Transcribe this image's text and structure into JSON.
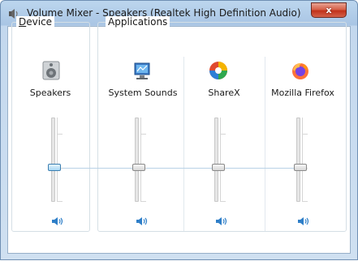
{
  "window": {
    "title": "Volume Mixer - Speakers (Realtek High Definition Audio)",
    "close_label": "x"
  },
  "groups": {
    "device_label_underlined": "D",
    "device_label_rest": "evice",
    "applications_label": "Applications"
  },
  "channels": [
    {
      "name": "Speakers",
      "icon": "speaker-device-icon",
      "volume_fraction": 0.3,
      "active": true
    },
    {
      "name": "System Sounds",
      "icon": "system-sounds-icon",
      "volume_fraction": 0.3,
      "active": false
    },
    {
      "name": "ShareX",
      "icon": "sharex-icon",
      "volume_fraction": 0.3,
      "active": false
    },
    {
      "name": "Mozilla Firefox",
      "icon": "firefox-icon",
      "volume_fraction": 0.3,
      "active": false
    }
  ],
  "colors": {
    "accent": "#2f7fc8",
    "close_red": "#c9432c"
  }
}
